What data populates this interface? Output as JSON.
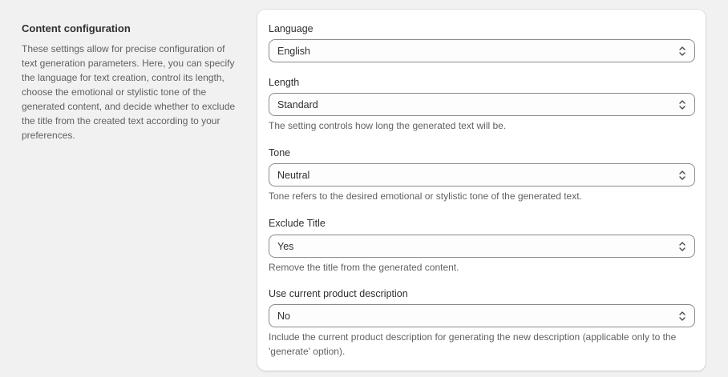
{
  "section": {
    "title": "Content configuration",
    "description": "These settings allow for precise configuration of text generation parameters. Here, you can specify the language for text creation, control its length, choose the emotional or stylistic tone of the generated content, and decide whether to exclude the title from the created text according to your preferences."
  },
  "fields": {
    "language": {
      "label": "Language",
      "value": "English",
      "help": ""
    },
    "length": {
      "label": "Length",
      "value": "Standard",
      "help": "The setting controls how long the generated text will be."
    },
    "tone": {
      "label": "Tone",
      "value": "Neutral",
      "help": "Tone refers to the desired emotional or stylistic tone of the generated text."
    },
    "exclude_title": {
      "label": "Exclude Title",
      "value": "Yes",
      "help": "Remove the title from the generated content."
    },
    "use_description": {
      "label": "Use current product description",
      "value": "No",
      "help": "Include the current product description for generating the new description (applicable only to the 'generate' option)."
    }
  },
  "icons": {
    "select_indicator": "chevron-up-down-icon"
  },
  "colors": {
    "page_bg": "#f1f1f1",
    "card_bg": "#ffffff",
    "select_border": "#8a8a8a",
    "help_text": "#616161"
  }
}
